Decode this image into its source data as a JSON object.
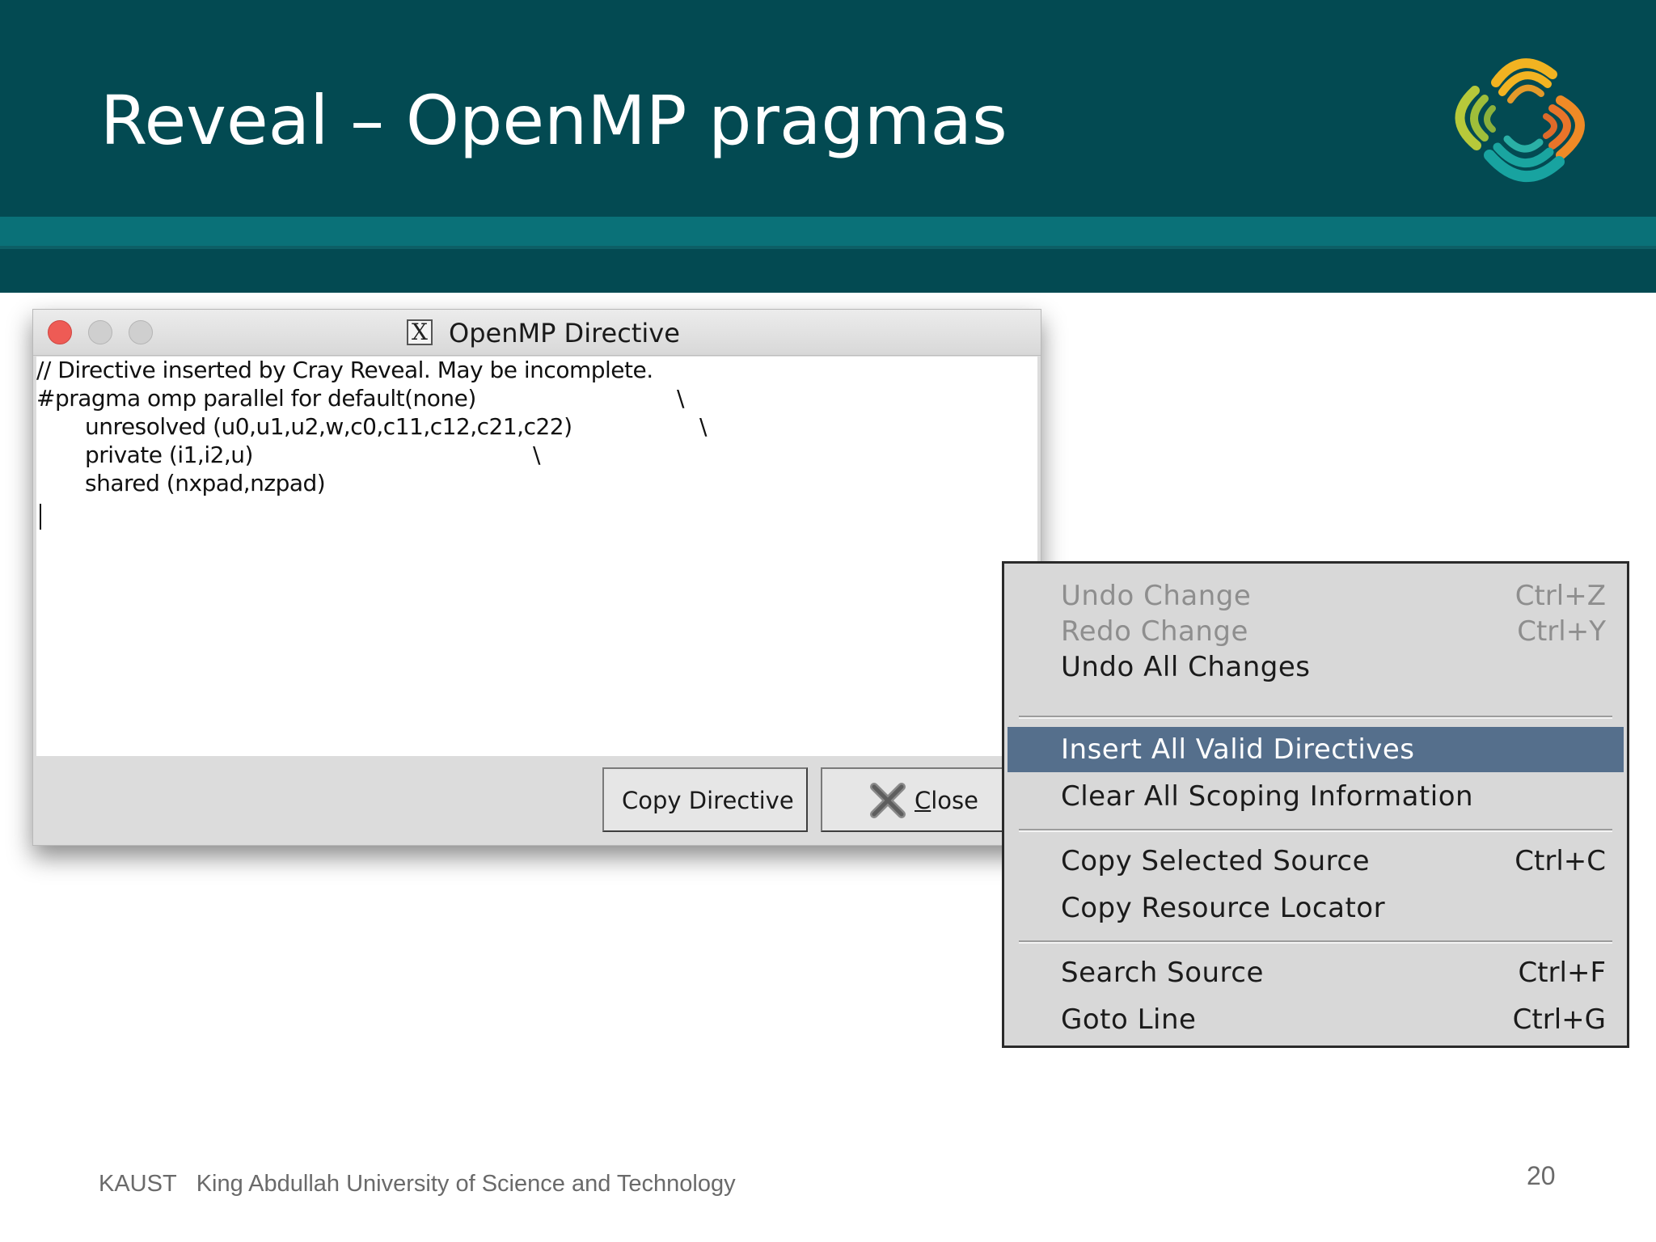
{
  "slide": {
    "title": "Reveal – OpenMP pragmas",
    "footer_org": "KAUST",
    "footer_institution": "King Abdullah University of Science and Technology",
    "page_number": "20",
    "logo_icon": "kaust-logo-icon",
    "colors": {
      "header": "#034a52",
      "band": "#0a7178"
    }
  },
  "dialog": {
    "window_title": "OpenMP Directive",
    "app_icon": "x11-icon",
    "code_lines": [
      "// Directive inserted by Cray Reveal.  May be incomplete.",
      "#pragma omp parallel for default(none)",
      "unresolved (u0,u1,u2,w,c0,c11,c12,c21,c22)",
      "private (i1,i2,u)",
      "shared  (nxpad,nzpad)"
    ],
    "continuation": "\\",
    "copy_button": "Copy Directive",
    "close_button_mnemonic": "C",
    "close_button_rest": "lose"
  },
  "context_menu": {
    "items": [
      {
        "label": "Undo Change",
        "shortcut": "Ctrl+Z",
        "state": "disabled"
      },
      {
        "label": "Redo Change",
        "shortcut": "Ctrl+Y",
        "state": "disabled"
      },
      {
        "label": "Undo All Changes",
        "shortcut": "",
        "state": "enabled"
      },
      {
        "label": "Insert All Valid Directives",
        "shortcut": "",
        "state": "highlighted"
      },
      {
        "label": "Clear All Scoping Information",
        "shortcut": "",
        "state": "enabled"
      },
      {
        "label": "Copy Selected Source",
        "shortcut": "Ctrl+C",
        "state": "enabled"
      },
      {
        "label": "Copy Resource Locator",
        "shortcut": "",
        "state": "enabled"
      },
      {
        "label": "Search Source",
        "shortcut": "Ctrl+F",
        "state": "enabled"
      },
      {
        "label": "Goto Line",
        "shortcut": "Ctrl+G",
        "state": "enabled"
      }
    ],
    "highlight_color": "#556f8c"
  }
}
